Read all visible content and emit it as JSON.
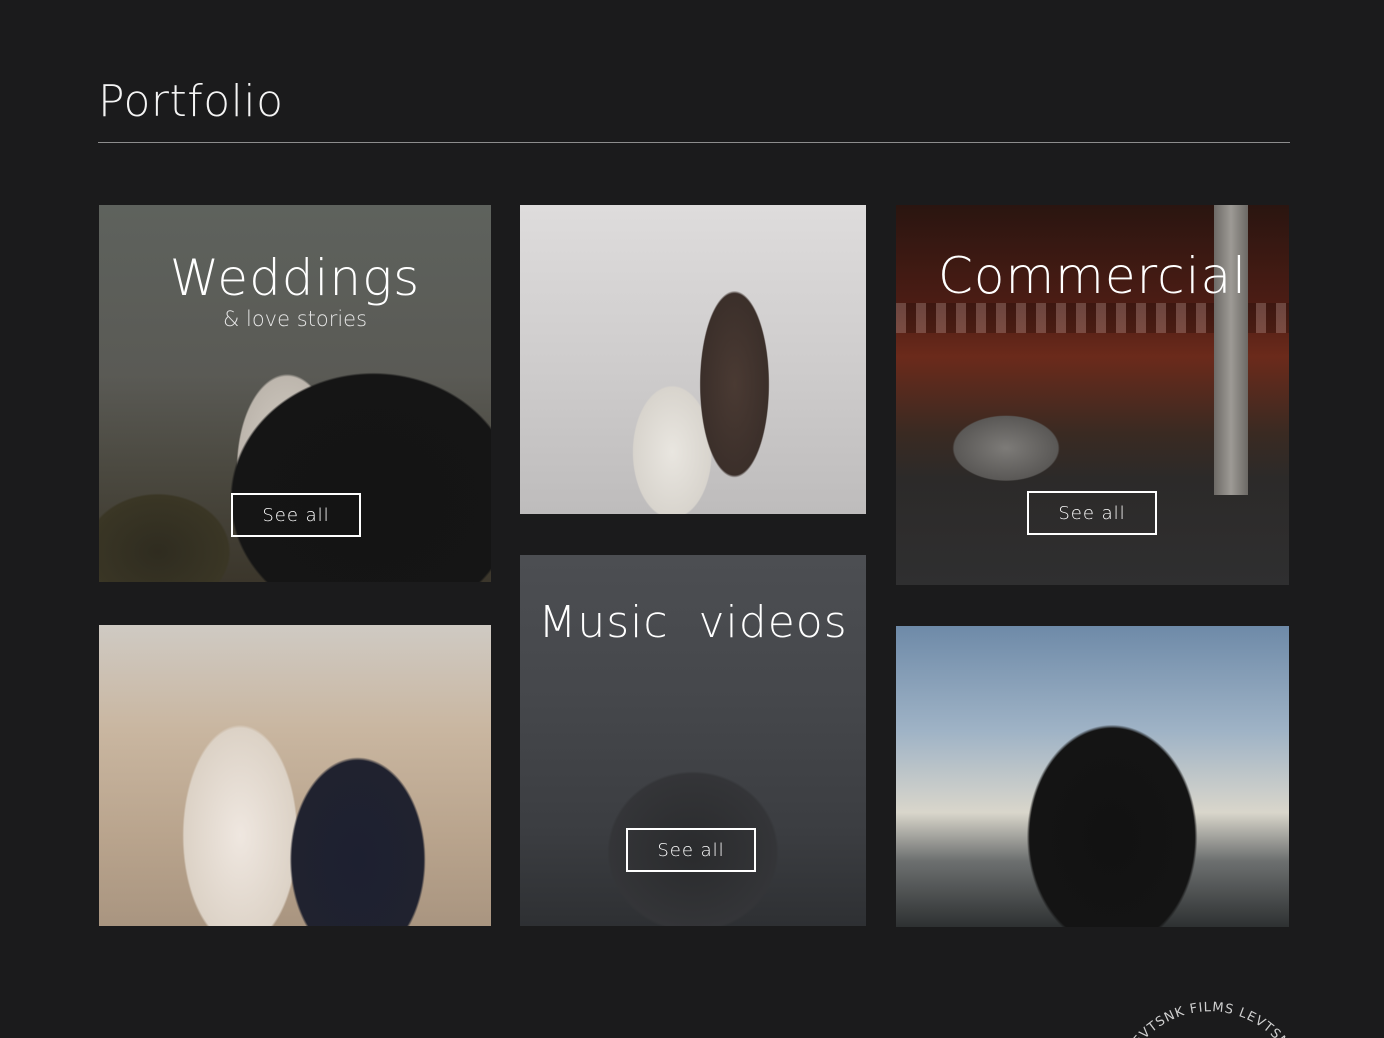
{
  "page": {
    "title": "Portfolio"
  },
  "tiles": {
    "weddings": {
      "title": "Weddings",
      "subtitle": "& love stories",
      "button": "See all"
    },
    "commercial": {
      "title": "Commercial",
      "button": "See all"
    },
    "music": {
      "title": "Music  videos",
      "button": "See all"
    }
  },
  "stamp": {
    "text": "LEVTSNK FILMS  LEVTSNK"
  },
  "colors": {
    "background": "#1b1b1c",
    "divider": "#8d8d8d",
    "text": "#ffffff"
  }
}
